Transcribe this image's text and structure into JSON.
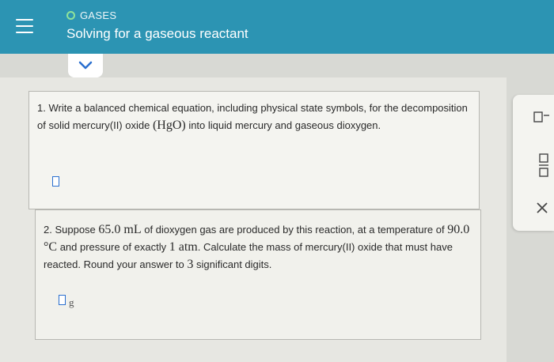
{
  "header": {
    "topic": "GASES",
    "title": "Solving for a gaseous reactant"
  },
  "question1": {
    "prefix": "1. Write a balanced chemical equation, including physical state symbols, for the decomposition of solid mercury(II) oxide ",
    "formula": "(HgO)",
    "suffix": " into liquid mercury and gaseous dioxygen."
  },
  "question2": {
    "t1": "2. Suppose ",
    "v1": "65.0 mL",
    "t2": " of dioxygen gas are produced by this reaction, at a temperature of ",
    "v2": "90.0 °C",
    "t3": " and pressure of exactly ",
    "v3": "1 atm",
    "t4": ". Calculate the mass of mercury(II) oxide that must have reacted. Round your answer to ",
    "v4": "3",
    "t5": " significant digits.",
    "unit": "g"
  },
  "colors": {
    "header_bg": "#2c94b3",
    "topic_circle": "#8fe39a",
    "chevron": "#2a6fcf",
    "answer_box_border": "#2a6fcf"
  },
  "icons": {
    "menu": "hamburger-menu-icon",
    "expand": "chevron-down-icon",
    "tool1": "superscript-tool-icon",
    "tool2": "fraction-tool-icon",
    "clear": "close-icon"
  }
}
